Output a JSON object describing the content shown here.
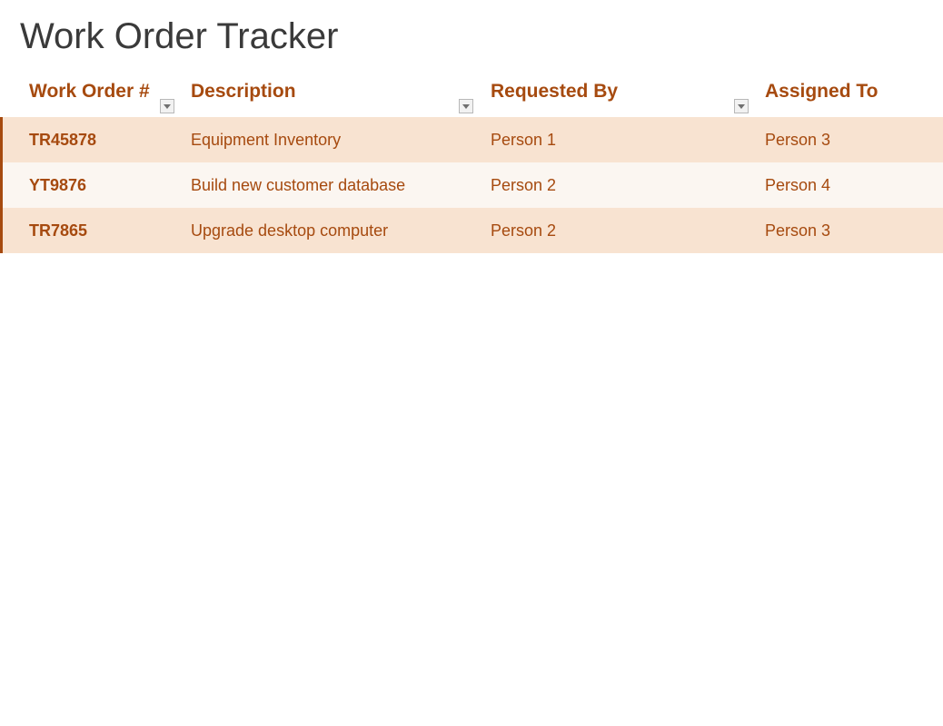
{
  "title": "Work Order Tracker",
  "columns": {
    "order": "Work Order #",
    "description": "Description",
    "requested_by": "Requested By",
    "assigned_to": "Assigned To"
  },
  "rows": [
    {
      "order": "TR45878",
      "description": "Equipment Inventory",
      "requested_by": "Person 1",
      "assigned_to": "Person 3"
    },
    {
      "order": "YT9876",
      "description": "Build new customer database",
      "requested_by": "Person 2",
      "assigned_to": "Person 4"
    },
    {
      "order": "TR7865",
      "description": "Upgrade desktop computer",
      "requested_by": "Person 2",
      "assigned_to": "Person 3"
    }
  ]
}
